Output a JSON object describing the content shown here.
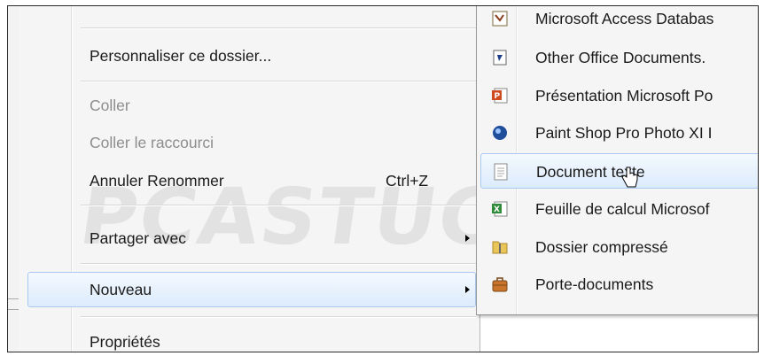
{
  "main_menu": {
    "customize_label": "Personnaliser ce dossier...",
    "paste_label": "Coller",
    "paste_shortcut_label": "Coller le raccourci",
    "undo_label": "Annuler Renommer",
    "undo_shortcut": "Ctrl+Z",
    "share_label": "Partager avec",
    "new_label": "Nouveau",
    "properties_label": "Propriétés"
  },
  "submenu": {
    "items": [
      {
        "label": "Microsoft Access Databas",
        "icon": "access-database-icon"
      },
      {
        "label": "Other Office Documents.",
        "icon": "office-document-icon"
      },
      {
        "label": "Présentation Microsoft Po",
        "icon": "powerpoint-icon"
      },
      {
        "label": "Paint Shop Pro Photo XI I",
        "icon": "paint-shop-pro-icon"
      },
      {
        "label": "Document texte",
        "icon": "text-document-icon"
      },
      {
        "label": "Feuille de calcul Microsof",
        "icon": "excel-spreadsheet-icon"
      },
      {
        "label": "Dossier compressé",
        "icon": "zip-folder-icon"
      },
      {
        "label": "Porte-documents",
        "icon": "briefcase-icon"
      }
    ]
  },
  "watermark": "PCASTUCES",
  "colors": {
    "hover_bg": "#dcebfb",
    "hover_border": "#a9c9ee",
    "disabled_text": "#8d8d8d",
    "menu_bg": "#f5f5f5"
  }
}
